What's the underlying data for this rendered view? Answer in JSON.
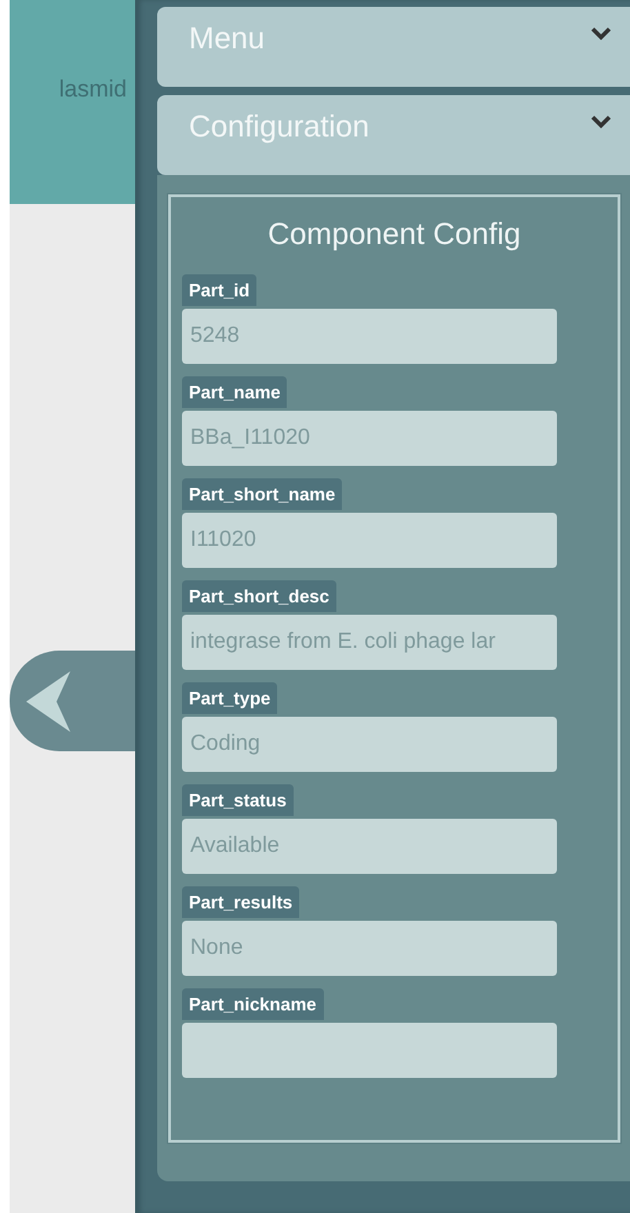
{
  "background": {
    "label": "lasmid"
  },
  "sections": [
    {
      "title": "Menu"
    },
    {
      "title": "Configuration"
    }
  ],
  "config": {
    "title": "Component Config",
    "fields": [
      {
        "label": "Part_id",
        "value": "5248"
      },
      {
        "label": "Part_name",
        "value": "BBa_I11020"
      },
      {
        "label": "Part_short_name",
        "value": "I11020"
      },
      {
        "label": "Part_short_desc",
        "value": "integrase from E. coli phage lar"
      },
      {
        "label": "Part_type",
        "value": "Coding"
      },
      {
        "label": "Part_status",
        "value": "Available"
      },
      {
        "label": "Part_results",
        "value": "None"
      },
      {
        "label": "Part_nickname"
      }
    ]
  }
}
